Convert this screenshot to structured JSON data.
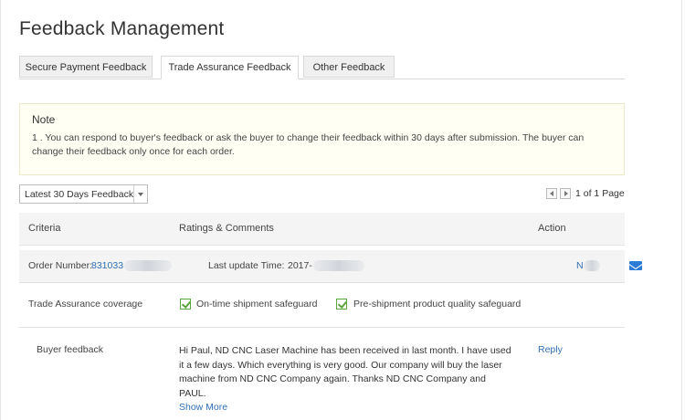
{
  "page": {
    "title": "Feedback Management"
  },
  "tabs": [
    {
      "label": "Secure Payment Feedback",
      "active": false
    },
    {
      "label": "Trade Assurance Feedback",
      "active": true
    },
    {
      "label": "Other Feedback",
      "active": false
    }
  ],
  "note": {
    "title": "Note",
    "text": "1 . You can respond to buyer's feedback or ask the buyer to change their feedback within 30 days after submission. The buyer can change their feedback only once for each order."
  },
  "filter": {
    "selected": "Latest 30 Days Feedback"
  },
  "pager": {
    "text": "1 of 1 Page"
  },
  "table": {
    "headers": {
      "criteria": "Criteria",
      "ratings": "Ratings & Comments",
      "action": "Action"
    },
    "order": {
      "label": "Order Number:",
      "number": "831033",
      "update_label": "Last update Time:",
      "update_value": "2017-",
      "action_text": "N"
    },
    "coverage": {
      "label": "Trade Assurance coverage",
      "items": [
        "On-time shipment safeguard",
        "Pre-shipment product quality safeguard"
      ]
    },
    "buyer_feedback": {
      "label": "Buyer feedback",
      "text": "Hi Paul, ND CNC Laser Machine has been received in last month. I have used it a few days. Which everything is very good. Our company will buy the laser machine from ND CNC Company again. Thanks ND CNC Company and PAUL.",
      "show_more": "Show More",
      "reply": "Reply"
    }
  },
  "colors": {
    "link": "#2f6fb5",
    "check": "#5aa53c",
    "mail_icon": "#2b7bd6",
    "note_bg": "#fffff4"
  }
}
